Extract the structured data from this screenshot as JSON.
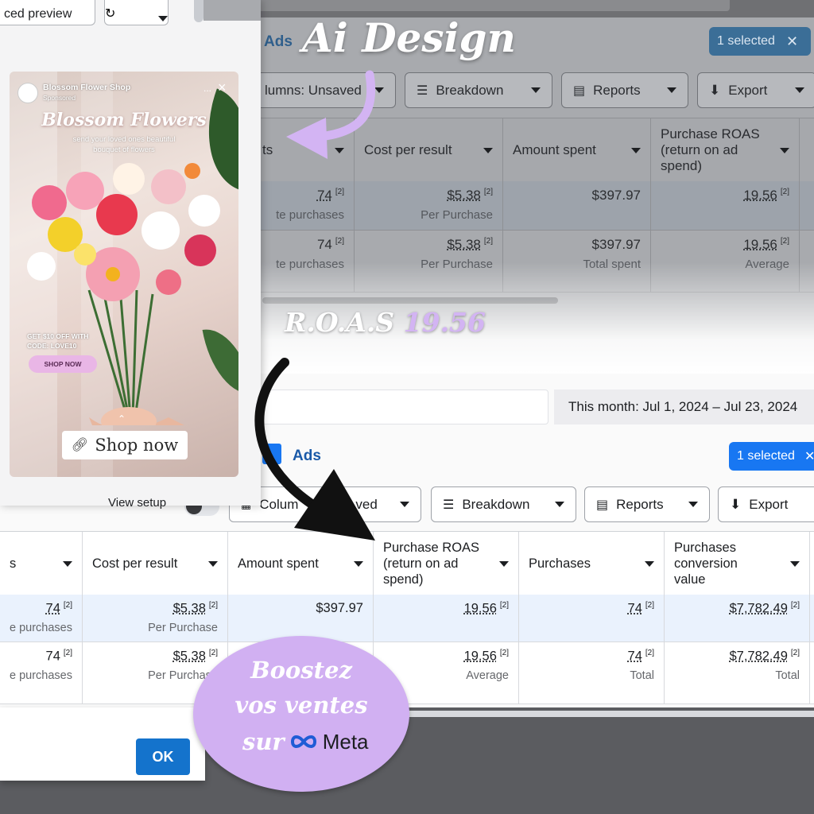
{
  "overlay": {
    "headline": "Ai Design",
    "roas_prefix": "R.O.A.S",
    "roas_value": "19.56",
    "boost_line1": "Boostez",
    "boost_line2": "vos ventes",
    "boost_line3": "sur",
    "meta_word": "Meta",
    "colors": {
      "lavender": "#d3b4f3",
      "arrow": "#111111"
    }
  },
  "dialog": {
    "preview_button": "ced preview",
    "share_icon": "share-icon",
    "view_setup_label": "View setup",
    "ok_label": "OK"
  },
  "ad": {
    "page_name": "Blossom Flower Shop",
    "sponsored": "Sponsored",
    "more_icon": "...",
    "close_icon": "×",
    "title": "Blossom Flowers",
    "tagline_1": "send your loved ones beautiful",
    "tagline_2": "bouquet of flowers",
    "promo_1": "GET $10 OFF WITH",
    "promo_2": "CODE: LOVE10",
    "promo_button": "SHOP NOW",
    "cta_label": "Shop now",
    "cta_icon": "link-icon"
  },
  "top": {
    "ads_label": "Ads",
    "selected_label": "1 selected",
    "columns_label": "lumns: Unsaved",
    "breakdown_label": "Breakdown",
    "reports_label": "Reports",
    "export_label": "Export",
    "headers": {
      "results": "ts",
      "cost": "Cost per result",
      "amount": "Amount spent",
      "roas": "Purchase ROAS (return on ad spend)"
    },
    "rows": [
      {
        "results": "74",
        "results_sub": "te purchases",
        "cost": "$5.38",
        "cost_sub": "Per Purchase",
        "amount": "$397.97",
        "amount_sub": "",
        "roas": "19.56",
        "roas_sub": ""
      },
      {
        "results": "74",
        "results_sub": "te purchases",
        "cost": "$5.38",
        "cost_sub": "Per Purchase",
        "amount": "$397.97",
        "amount_sub": "Total spent",
        "roas": "19.56",
        "roas_sub": "Average"
      }
    ],
    "footnote": "[2]"
  },
  "bottom": {
    "date_range": "This month: Jul 1, 2024 – Jul 23, 2024",
    "ads_label": "Ads",
    "selected_label": "1 selected",
    "columns_label": "Colum",
    "columns_suffix": "ved",
    "breakdown_label": "Breakdown",
    "reports_label": "Reports",
    "export_label": "Export",
    "headers": {
      "results": "s",
      "cost": "Cost per result",
      "amount": "Amount spent",
      "roas": "Purchase ROAS (return on ad spend)",
      "purchases": "Purchases",
      "value": "Purchases conversion value"
    },
    "rows": [
      {
        "results": "74",
        "results_sub": "e purchases",
        "cost": "$5.38",
        "cost_sub": "Per Purchase",
        "amount": "$397.97",
        "roas": "19.56",
        "roas_sub": "",
        "purchases": "74",
        "purchases_sub": "",
        "value": "$7,782.49",
        "value_sub": ""
      },
      {
        "results": "74",
        "results_sub": "e purchases",
        "cost": "$5.38",
        "cost_sub": "Per Purchase",
        "amount": "",
        "roas": "19.56",
        "roas_sub": "Average",
        "purchases": "74",
        "purchases_sub": "Total",
        "value": "$7,782.49",
        "value_sub": "Total"
      }
    ],
    "footnote": "[2]"
  }
}
